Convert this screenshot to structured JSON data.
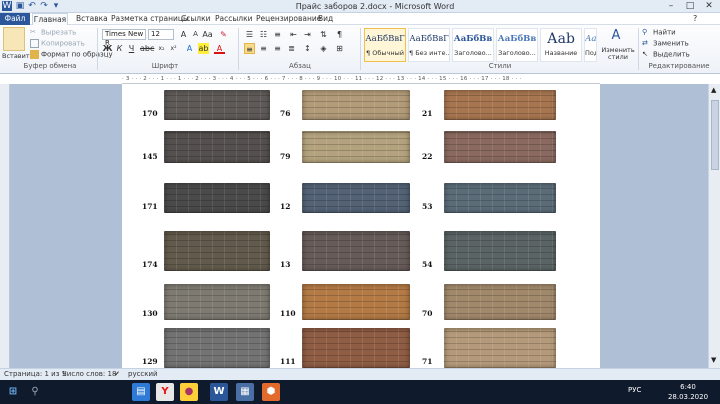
{
  "window": {
    "title": "Прайс заборов 2.docx - Microsoft Word",
    "minimize": "–",
    "maximize": "□",
    "close": "✕"
  },
  "tabs": [
    "Файл",
    "Главная",
    "Вставка",
    "Разметка страницы",
    "Ссылки",
    "Рассылки",
    "Рецензирование",
    "Вид"
  ],
  "clipboard": {
    "paste": "Вставить",
    "cut": "Вырезать",
    "copy": "Копировать",
    "format_painter": "Формат по образцу",
    "label": "Буфер обмена"
  },
  "font": {
    "name": "Times New R",
    "size": "12",
    "label": "Шрифт",
    "bold": "Ж",
    "italic": "К",
    "underline": "Ч"
  },
  "paragraph": {
    "label": "Абзац"
  },
  "styles": {
    "label": "Стили",
    "items": [
      {
        "preview": "АаБбВвГ",
        "name": "¶ Обычный"
      },
      {
        "preview": "АаБбВвГ",
        "name": "¶ Без инте..."
      },
      {
        "preview": "АаБбВв",
        "name": "Заголово..."
      },
      {
        "preview": "АаБбВв",
        "name": "Заголово..."
      },
      {
        "preview": "Ааb",
        "name": "Название"
      },
      {
        "preview": "АаБбВв",
        "name": "Подзагол..."
      }
    ],
    "change": "Изменить стили"
  },
  "editing": {
    "label": "Редактирование",
    "find": "Найти",
    "replace": "Заменить",
    "select": "Выделить"
  },
  "ruler": {
    "marks": "· 3 · · · 2 · · · 1 · · · 1 · · · 2 · · · 3 · · · 4 · · · 5 · · · 6 · · · 7 · · · 8 · · · 9 · · · 10 · · · 11 · · · 12 · · · 13 · · · 14 · · · 15 · · · 16 · · · 17 · · · 18 · · ·"
  },
  "fences": [
    {
      "num": "170",
      "color": "#5f5a58"
    },
    {
      "num": "76",
      "color": "#b29b78"
    },
    {
      "num": "21",
      "color": "#a77650"
    },
    {
      "num": "145",
      "color": "#55504f"
    },
    {
      "num": "79",
      "color": "#b3a27d"
    },
    {
      "num": "22",
      "color": "#8a6a60"
    },
    {
      "num": "171",
      "color": "#4a4a4a"
    },
    {
      "num": "12",
      "color": "#536275"
    },
    {
      "num": "53",
      "color": "#5b6c78"
    },
    {
      "num": "174",
      "color": "#625a4c"
    },
    {
      "num": "13",
      "color": "#665b58"
    },
    {
      "num": "54",
      "color": "#5a6464"
    },
    {
      "num": "130",
      "color": "#7e7a71"
    },
    {
      "num": "110",
      "color": "#b37a45"
    },
    {
      "num": "70",
      "color": "#a1886b"
    },
    {
      "num": "129",
      "color": "#737373"
    },
    {
      "num": "111",
      "color": "#8e5d44"
    },
    {
      "num": "71",
      "color": "#b49a7a"
    }
  ],
  "status": {
    "page": "Страница: 1 из 1",
    "words": "Число слов: 18",
    "language": "русский"
  },
  "taskbar": {
    "lang": "РУС",
    "time": "6:40",
    "date": "28.03.2020"
  }
}
